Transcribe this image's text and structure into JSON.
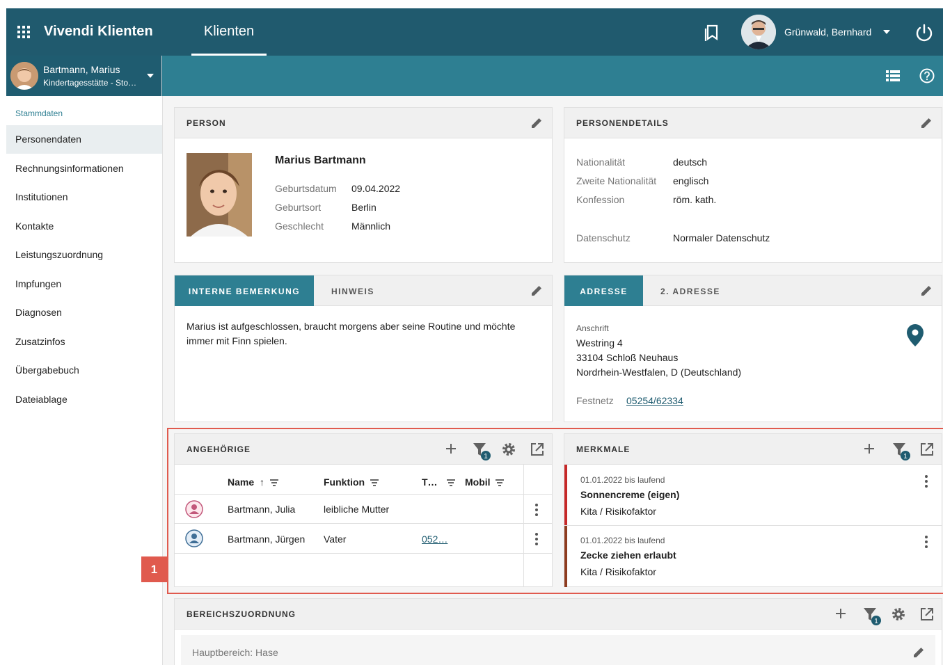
{
  "app": {
    "title": "Vivendi Klienten",
    "nav_tab": "Klienten",
    "user_name": "Grünwald, Bernhard"
  },
  "client": {
    "name": "Bartmann, Marius",
    "sub": "Kindertagesstätte - Sto…"
  },
  "sidebar": {
    "section": "Stammdaten",
    "items": [
      {
        "label": "Personendaten",
        "active": true
      },
      {
        "label": "Rechnungsinformationen"
      },
      {
        "label": "Institutionen"
      },
      {
        "label": "Kontakte"
      },
      {
        "label": "Leistungszuordnung"
      },
      {
        "label": "Impfungen"
      },
      {
        "label": "Diagnosen"
      },
      {
        "label": "Zusatzinfos"
      },
      {
        "label": "Übergabebuch"
      },
      {
        "label": "Dateiablage"
      }
    ]
  },
  "person": {
    "title": "PERSON",
    "full_name": "Marius Bartmann",
    "fields": [
      {
        "label": "Geburtsdatum",
        "value": "09.04.2022"
      },
      {
        "label": "Geburtsort",
        "value": "Berlin"
      },
      {
        "label": "Geschlecht",
        "value": "Männlich"
      }
    ]
  },
  "details": {
    "title": "PERSONENDETAILS",
    "fields": [
      {
        "label": "Nationalität",
        "value": "deutsch"
      },
      {
        "label": "Zweite Nationalität",
        "value": "englisch"
      },
      {
        "label": "Konfession",
        "value": "röm. kath."
      },
      {
        "label": "Datenschutz",
        "value": "Normaler Datenschutz"
      }
    ]
  },
  "remarks": {
    "tab_active": "INTERNE BEMERKUNG",
    "tab_other": "HINWEIS",
    "text_line1": "Marius ist aufgeschlossen, braucht morgens aber seine Routine und möchte",
    "text_line2": "immer mit Finn spielen."
  },
  "address": {
    "tab_active": "ADRESSE",
    "tab_other": "2. ADRESSE",
    "label": "Anschrift",
    "line1": "Westring 4",
    "line2": "33104 Schloß Neuhaus",
    "line3": "Nordrhein-Westfalen,  D (Deutschland)",
    "phone_label": "Festnetz",
    "phone": "05254/62334"
  },
  "relatives": {
    "title": "ANGEHÖRIGE",
    "filter_count": "1",
    "columns": [
      "Name",
      "Funktion",
      "T…",
      "Mobil"
    ],
    "sort_arrow": "↑",
    "rows": [
      {
        "name": "Bartmann, Julia",
        "function": "leibliche Mutter",
        "tel": "",
        "mobile": ""
      },
      {
        "name": "Bartmann, Jürgen",
        "function": "Vater",
        "tel": "052…",
        "mobile": ""
      }
    ]
  },
  "features": {
    "title": "MERKMALE",
    "filter_count": "1",
    "items": [
      {
        "date": "01.01.2022 bis laufend",
        "title": "Sonnencreme (eigen)",
        "category": "Kita / Risikofaktor",
        "color": "#c62828"
      },
      {
        "date": "01.01.2022 bis laufend",
        "title": "Zecke ziehen erlaubt",
        "category": "Kita / Risikofaktor",
        "color": "#8d3b1f"
      }
    ]
  },
  "areas": {
    "title": "BEREICHSZUORDNUNG",
    "filter_count": "1",
    "main_area": "Hauptbereich: Hase"
  },
  "callout": {
    "number": "1"
  },
  "colors": {
    "primary_dark": "#205a6e",
    "primary": "#2e7f92",
    "accent_red": "#e05a4e"
  }
}
